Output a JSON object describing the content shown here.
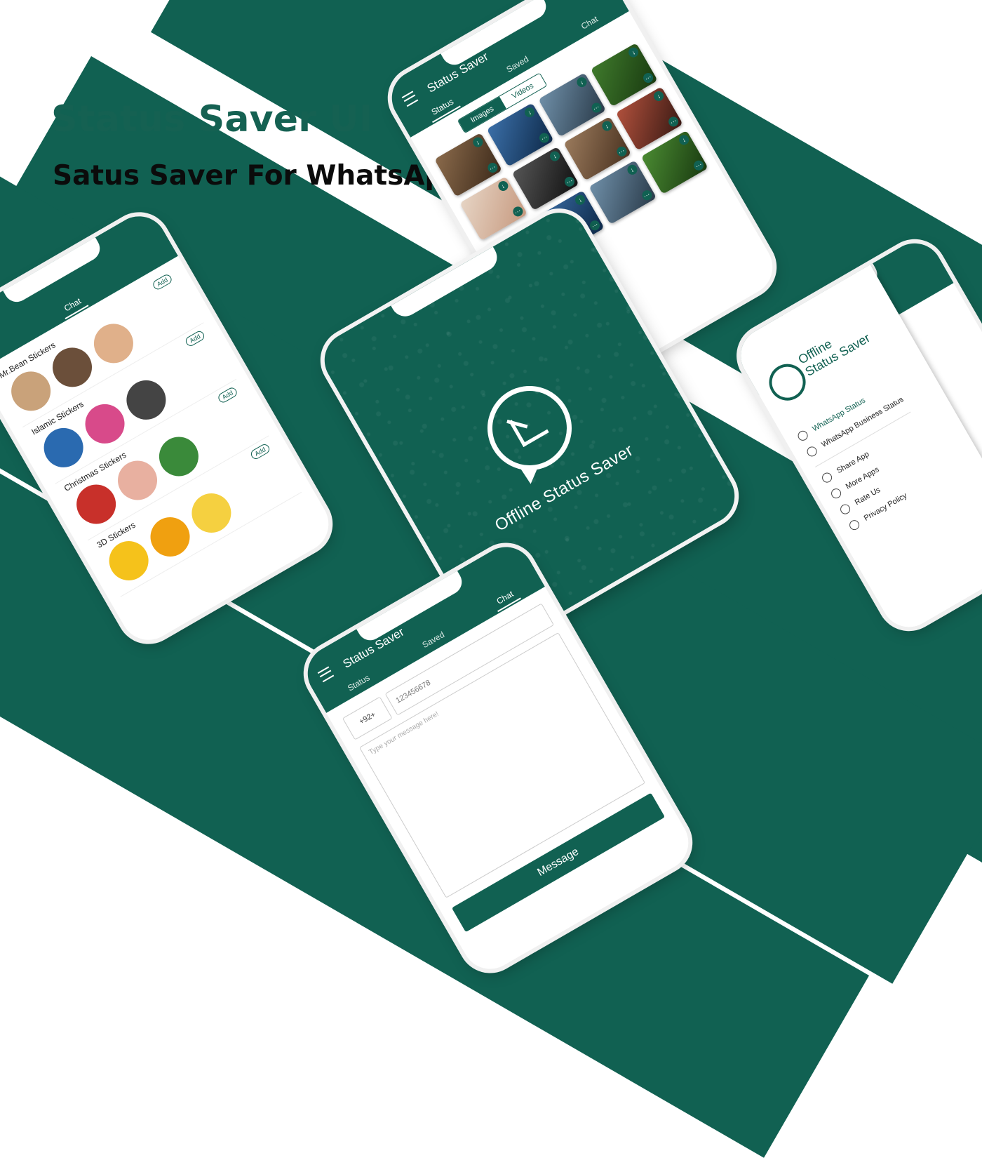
{
  "hero": {
    "title": "Status Saver UI",
    "subtitle": "Satus Saver For WhatsApp"
  },
  "app": {
    "title": "Status Saver",
    "tabs": [
      "Status",
      "Saved",
      "Chat"
    ],
    "subtabs": [
      "Images",
      "Videos"
    ]
  },
  "splash": {
    "name": "Offline Status Saver"
  },
  "stickers": {
    "tab": "Chat",
    "add_label": "Add",
    "packs": [
      "Mr.Bean Stickers",
      "Islamic Stickers",
      "Christmas Stickers",
      "3D Stickers"
    ]
  },
  "chat": {
    "country_code": "+92+",
    "number_placeholder": "123456678",
    "message_placeholder": "Type your message here!",
    "send_label": "Message"
  },
  "drawer": {
    "brand_line1": "Offline",
    "brand_line2": "Status Saver",
    "items": [
      {
        "label": "WhatsApp Status",
        "icon": "whatsapp-icon"
      },
      {
        "label": "WhatsApp Business Status",
        "icon": "business-icon"
      },
      {
        "label": "Share App",
        "icon": "share-icon"
      },
      {
        "label": "More Apps",
        "icon": "apps-icon"
      },
      {
        "label": "Rate Us",
        "icon": "star-icon"
      },
      {
        "label": "Privacy Policy",
        "icon": "shield-icon"
      }
    ]
  },
  "colors": {
    "brand": "#116152",
    "background": "#ffffff"
  }
}
